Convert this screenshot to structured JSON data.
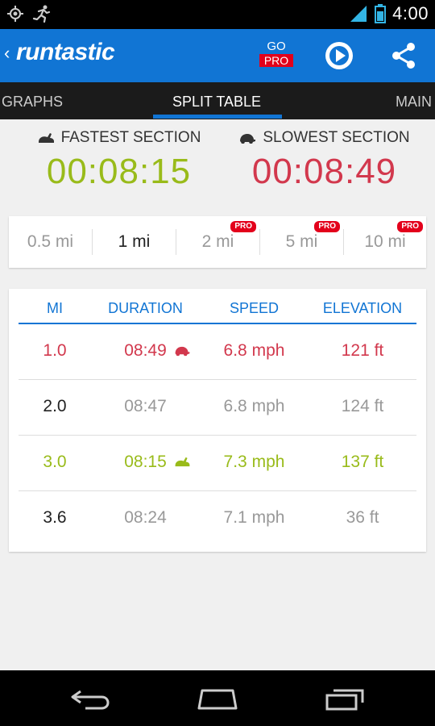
{
  "status_bar": {
    "time": "4:00"
  },
  "action_bar": {
    "logo_text": "runtastic",
    "go_label": "GO",
    "pro_label": "PRO"
  },
  "tabs": [
    {
      "label": "GRAPHS"
    },
    {
      "label": "SPLIT TABLE",
      "active": true
    },
    {
      "label": "MAIN"
    }
  ],
  "summary": {
    "fastest_label": "FASTEST SECTION",
    "fastest_value": "00:08:15",
    "slowest_label": "SLOWEST SECTION",
    "slowest_value": "00:08:49"
  },
  "intervals": [
    {
      "label": "0.5 mi",
      "selected": false,
      "pro": false
    },
    {
      "label": "1 mi",
      "selected": true,
      "pro": false
    },
    {
      "label": "2 mi",
      "selected": false,
      "pro": true
    },
    {
      "label": "5 mi",
      "selected": false,
      "pro": true
    },
    {
      "label": "10 mi",
      "selected": false,
      "pro": true
    }
  ],
  "pro_badge": "PRO",
  "table": {
    "headers": {
      "mi": "MI",
      "duration": "DURATION",
      "speed": "SPEED",
      "elevation": "ELEVATION"
    },
    "rows": [
      {
        "mi": "1.0",
        "duration": "08:49",
        "speed": "6.8 mph",
        "elevation": "121 ft",
        "status": "slowest"
      },
      {
        "mi": "2.0",
        "duration": "08:47",
        "speed": "6.8 mph",
        "elevation": "124 ft",
        "status": "normal"
      },
      {
        "mi": "3.0",
        "duration": "08:15",
        "speed": "7.3 mph",
        "elevation": "137 ft",
        "status": "fastest"
      },
      {
        "mi": "3.6",
        "duration": "08:24",
        "speed": "7.1 mph",
        "elevation": "36 ft",
        "status": "normal"
      }
    ]
  },
  "colors": {
    "accent": "#1175d4",
    "fastest": "#99bb1a",
    "slowest": "#d2384d",
    "pro": "#e3001b"
  }
}
